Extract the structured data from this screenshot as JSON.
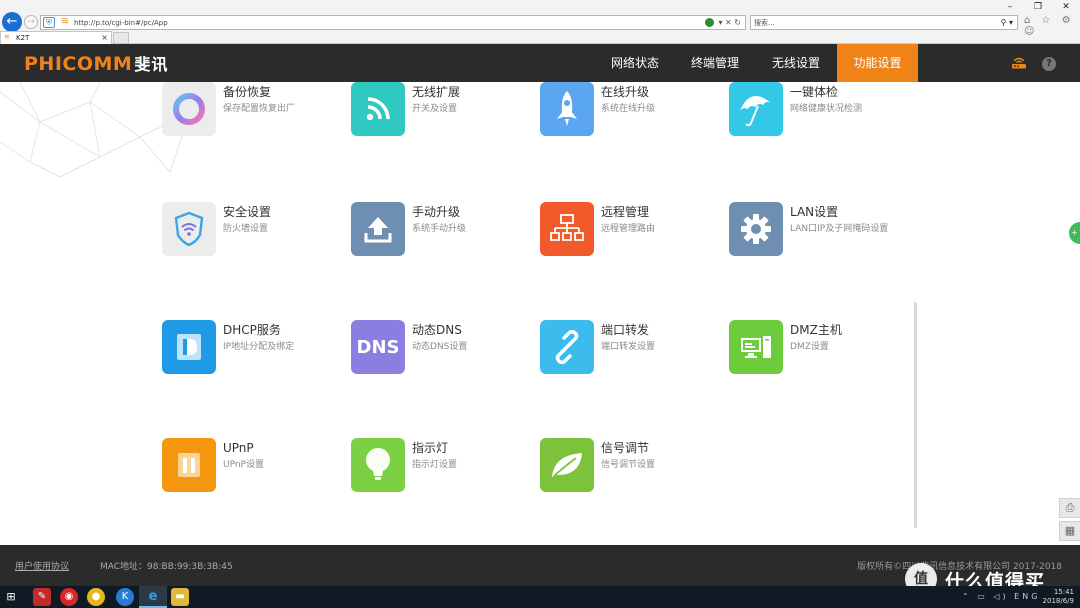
{
  "browser": {
    "url": "http://p.to/cgi-bin#/pc/App",
    "search_placeholder": "搜索...",
    "tab_title": "K2T",
    "tab_close": "×",
    "back_glyph": "←",
    "forward_glyph": "→",
    "address_right_icons": "▾ ✕ ↻",
    "search_icon": "⚲ ▾",
    "window_controls": [
      "–",
      "❐",
      "✕"
    ],
    "toolbar_icons": "⌂ ☆ ⚙ ☺"
  },
  "header": {
    "logo": "PHICOMM",
    "logo_cn": "斐讯",
    "nav": [
      {
        "label": "网络状态",
        "active": false
      },
      {
        "label": "终端管理",
        "active": false
      },
      {
        "label": "无线设置",
        "active": false
      },
      {
        "label": "功能设置",
        "active": true
      }
    ],
    "help_glyph": "?",
    "accent": "#f08318",
    "bar_color": "#2b2b2b"
  },
  "tiles": [
    {
      "title": "备份恢复",
      "desc": "保存配置恢复出厂",
      "icon": "backup-ring-icon",
      "color": "#ececec"
    },
    {
      "title": "无线扩展",
      "desc": "开关及设置",
      "icon": "wifi-signal-icon",
      "color": "#2fc9c1"
    },
    {
      "title": "在线升级",
      "desc": "系统在线升级",
      "icon": "rocket-icon",
      "color": "#5aa6f0"
    },
    {
      "title": "一键体检",
      "desc": "网络健康状况检测",
      "icon": "umbrella-icon",
      "color": "#33c9e6"
    },
    {
      "title": "安全设置",
      "desc": "防火墙设置",
      "icon": "shield-wifi-icon",
      "color": "#ececec"
    },
    {
      "title": "手动升级",
      "desc": "系统手动升级",
      "icon": "upload-icon",
      "color": "#6f8fb2"
    },
    {
      "title": "远程管理",
      "desc": "远程管理路由",
      "icon": "network-tree-icon",
      "color": "#f25a2b"
    },
    {
      "title": "LAN设置",
      "desc": "LAN口IP及子网掩码设置",
      "icon": "gear-icon",
      "color": "#6f8fb2"
    },
    {
      "title": "DHCP服务",
      "desc": "IP地址分配及绑定",
      "icon": "dhcp-d-icon",
      "color": "#1f9ae6"
    },
    {
      "title": "动态DNS",
      "desc": "动态DNS设置",
      "icon": "dns-text-icon",
      "color": "#8a7fe0",
      "icon_text": "DNS"
    },
    {
      "title": "端口转发",
      "desc": "端口转发设置",
      "icon": "link-icon",
      "color": "#3bbcec"
    },
    {
      "title": "DMZ主机",
      "desc": "DMZ设置",
      "icon": "computer-icon",
      "color": "#6ccc3c"
    },
    {
      "title": "UPnP",
      "desc": "UPnP设置",
      "icon": "upnp-icon",
      "color": "#f5960f"
    },
    {
      "title": "指示灯",
      "desc": "指示灯设置",
      "icon": "bulb-icon",
      "color": "#7cd044"
    },
    {
      "title": "信号调节",
      "desc": "信号调节设置",
      "icon": "leaf-icon",
      "color": "#7cc23a"
    }
  ],
  "side": {
    "green_tab": "+",
    "btn1": "⎙",
    "btn2": "▦"
  },
  "footer": {
    "agreement": "用户使用协议",
    "mac": "MAC地址：98:BB:99:3B:3B:45",
    "copyright": "版权所有©四川斐讯信息技术有限公司 2017-2018"
  },
  "watermark": {
    "badge": "值",
    "text": "什么值得买"
  },
  "taskbar": {
    "start_glyph": "⊞",
    "apps": [
      "✎",
      "◉",
      "●",
      "K",
      "e",
      "▬"
    ],
    "tray_icons": "⌃ ▭ ◁) ENG",
    "time": "15:41",
    "date": "2018/6/9"
  }
}
